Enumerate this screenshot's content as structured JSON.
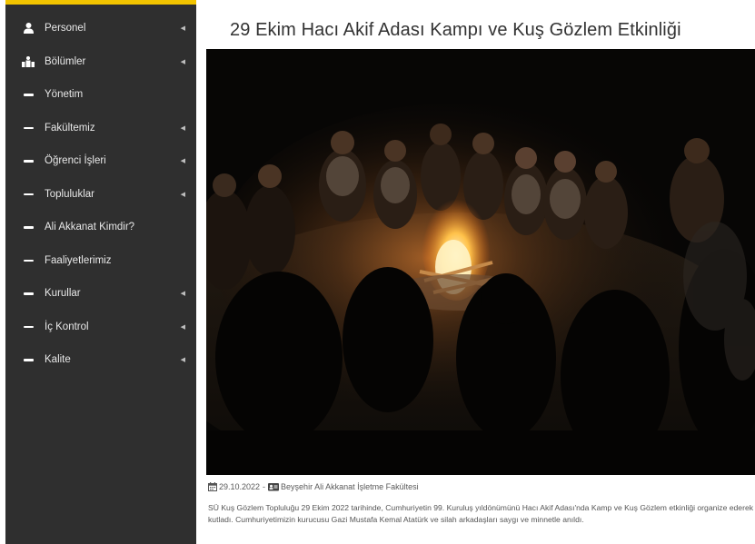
{
  "sidebar": {
    "items": [
      {
        "label": "Personel",
        "icon": "user-icon",
        "has_submenu": true
      },
      {
        "label": "Bölümler",
        "icon": "building-icon",
        "has_submenu": true
      },
      {
        "label": "Yönetim",
        "icon": "dash-icon",
        "has_submenu": false
      },
      {
        "label": "Fakültemiz",
        "icon": "dash-icon",
        "has_submenu": true
      },
      {
        "label": "Öğrenci İşleri",
        "icon": "dash-icon",
        "has_submenu": true
      },
      {
        "label": "Topluluklar",
        "icon": "dash-icon",
        "has_submenu": true
      },
      {
        "label": "Ali Akkanat Kimdir?",
        "icon": "dash-icon",
        "has_submenu": false
      },
      {
        "label": "Faaliyetlerimiz",
        "icon": "dash-icon",
        "has_submenu": false
      },
      {
        "label": "Kurullar",
        "icon": "dash-icon",
        "has_submenu": true
      },
      {
        "label": "İç Kontrol",
        "icon": "dash-icon",
        "has_submenu": true
      },
      {
        "label": "Kalite",
        "icon": "dash-icon",
        "has_submenu": true
      }
    ],
    "accent_color": "#f2c400",
    "background_color": "#2f2f2f"
  },
  "article": {
    "title": "29 Ekim Hacı Akif Adası Kampı ve Kuş Gözlem Etkinliği",
    "image_description": "",
    "date": "29.10.2022",
    "separator": "-",
    "source": "Beyşehir Ali Akkanat İşletme Fakültesi",
    "body": "SÜ Kuş Gözlem Topluluğu 29 Ekim 2022 tarihinde, Cumhuriyetin 99. Kuruluş yıldönümünü Hacı Akif Adası'nda Kamp ve Kuş Gözlem etkinliği organize ederek kutladı. Cumhuriyetimizin kurucusu Gazi Mustafa Kemal Atatürk ve silah arkadaşları saygı ve minnetle anıldı."
  }
}
